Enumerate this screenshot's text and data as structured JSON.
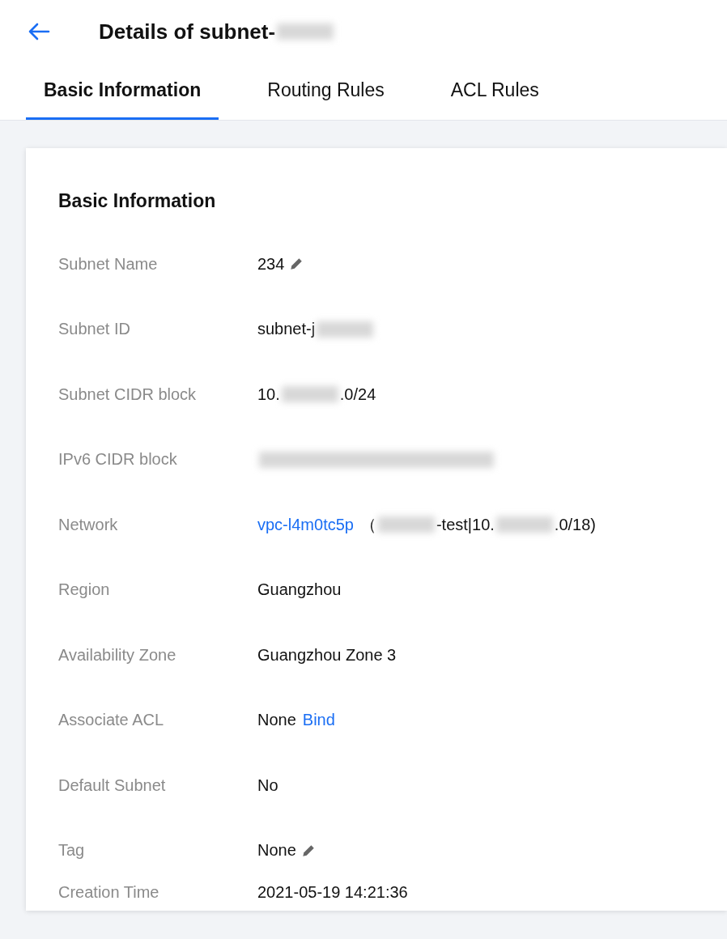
{
  "header": {
    "title": [
      {
        "kind": "text",
        "text": "Details of subnet-"
      },
      {
        "kind": "redacted"
      }
    ]
  },
  "tabs": [
    {
      "label": "Basic Information",
      "selected": true
    },
    {
      "label": "Routing Rules",
      "selected": false
    },
    {
      "label": "ACL Rules",
      "selected": false
    }
  ],
  "section": {
    "title": "Basic Information",
    "rows": [
      {
        "label": "Subnet Name",
        "editable": true,
        "value": [
          {
            "kind": "text",
            "text": "234"
          }
        ]
      },
      {
        "label": "Subnet ID",
        "editable": false,
        "value": [
          {
            "kind": "text",
            "text": "subnet-j"
          },
          {
            "kind": "redacted"
          }
        ]
      },
      {
        "label": "Subnet CIDR block",
        "editable": false,
        "value": [
          {
            "kind": "text",
            "text": "10."
          },
          {
            "kind": "redacted"
          },
          {
            "kind": "text",
            "text": ".0/24"
          }
        ]
      },
      {
        "label": "IPv6 CIDR block",
        "editable": false,
        "value": [
          {
            "kind": "redacted_long"
          }
        ]
      },
      {
        "label": "Network",
        "editable": false,
        "value": [
          {
            "kind": "link",
            "text": "vpc-l4m0tc5p"
          },
          {
            "kind": "text",
            "text": "（"
          },
          {
            "kind": "redacted"
          },
          {
            "kind": "text",
            "text": "-test|10."
          },
          {
            "kind": "redacted"
          },
          {
            "kind": "text",
            "text": ".0/18)"
          }
        ]
      },
      {
        "label": "Region",
        "editable": false,
        "value": [
          {
            "kind": "text",
            "text": "Guangzhou"
          }
        ]
      },
      {
        "label": "Availability Zone",
        "editable": false,
        "value": [
          {
            "kind": "text",
            "text": "Guangzhou Zone 3"
          }
        ]
      },
      {
        "label": "Associate ACL",
        "editable": false,
        "value": [
          {
            "kind": "text",
            "text": "None"
          },
          {
            "kind": "link",
            "text": "Bind"
          }
        ]
      },
      {
        "label": "Default Subnet",
        "editable": false,
        "value": [
          {
            "kind": "text",
            "text": "No"
          }
        ]
      },
      {
        "label": "Tag",
        "editable": true,
        "value": [
          {
            "kind": "text",
            "text": "None"
          }
        ]
      },
      {
        "label": "Creation Time",
        "editable": false,
        "value": [
          {
            "kind": "text",
            "text": "2021-05-19 14:21:36"
          }
        ]
      }
    ]
  }
}
